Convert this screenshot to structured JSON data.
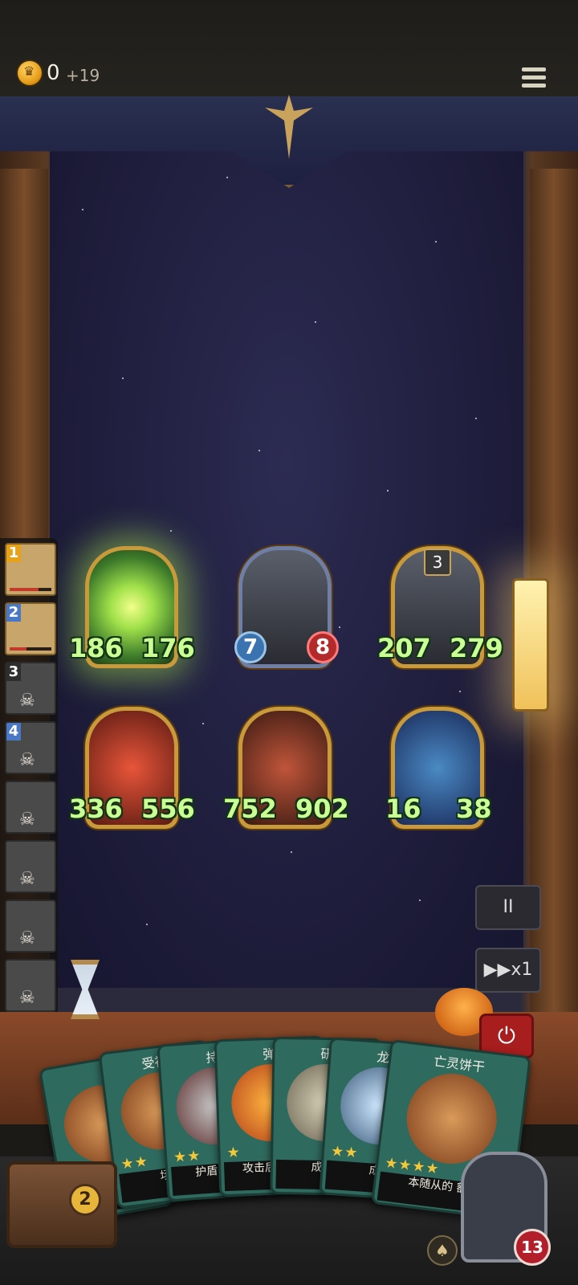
{
  "hud": {
    "gold": "0",
    "gold_income": "+19"
  },
  "board": {
    "top": [
      {
        "left": "186",
        "right": "176"
      },
      {
        "left": "7",
        "right": "8"
      },
      {
        "left": "207",
        "right": "279",
        "shield": "3"
      }
    ],
    "bottom": [
      {
        "left": "336",
        "right": "556"
      },
      {
        "left": "752",
        "right": "902"
      },
      {
        "left": "16",
        "right": "38"
      }
    ]
  },
  "queue": [
    "1",
    "2",
    "3",
    "4"
  ],
  "controls": {
    "pause": "II",
    "speed": "▶▶x1",
    "power": "⏻"
  },
  "hand": [
    {
      "title": "",
      "stars": "",
      "desc": ""
    },
    {
      "title": "受祝",
      "stars": "★★",
      "desc": "场:"
    },
    {
      "title": "持",
      "stars": "★★",
      "desc": "护盾 可以"
    },
    {
      "title": "弹",
      "stars": "★",
      "desc": "攻击后 敌方"
    },
    {
      "title": "研",
      "stars": "",
      "desc": "成长:"
    },
    {
      "title": "龙",
      "stars": "★★",
      "desc": "成"
    },
    {
      "title": "亡灵饼干",
      "stars": "★★★★",
      "desc": "本随从的 额外"
    }
  ],
  "chest_count": "2",
  "hero_hp": "13",
  "colors": {
    "stat_green": "#c9ff93",
    "badge_blue": "#3b73b0",
    "badge_red": "#b22a2a"
  }
}
